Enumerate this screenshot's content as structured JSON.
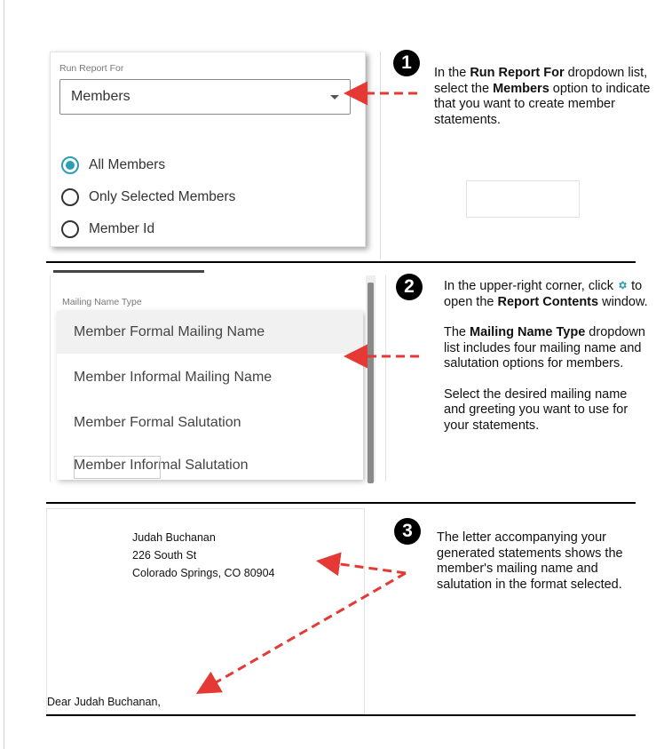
{
  "step1": {
    "number": "1",
    "panel": {
      "label": "Run Report For",
      "selected_value": "Members",
      "options": [
        {
          "label": "All Members",
          "checked": true
        },
        {
          "label": "Only Selected Members",
          "checked": false
        },
        {
          "label": "Member Id",
          "checked": false
        }
      ]
    },
    "text": {
      "a": "In the ",
      "b1": "Run Report For",
      "c": " dropdown list, select the ",
      "b2": "Members",
      "d": " option to indicate that you want to create member statements."
    }
  },
  "step2": {
    "number": "2",
    "panel": {
      "label": "Mailing Name Type",
      "items": [
        "Member Formal Mailing Name",
        "Member Informal Mailing Name",
        "Member Formal Salutation",
        "Member Informal Salutation"
      ]
    },
    "text": {
      "p1a": "In the upper-right corner, click ",
      "p1b": " to open the ",
      "p1bold": "Report Contents",
      "p1c": " window.",
      "p2bold": "Mailing Name Type",
      "p2pre": "The ",
      "p2rest": " dropdown list includes four mailing name and salutation options for members.",
      "p3": "Select the desired mailing name and greeting you want to use for your statements."
    },
    "gear_color": "#2a9fb4"
  },
  "step3": {
    "number": "3",
    "letter": {
      "name": "Judah Buchanan",
      "street": "226 South St",
      "city": "Colorado Springs, CO 80904",
      "greeting": "Dear Judah Buchanan,"
    },
    "text": "The letter accompanying your generated statements shows the member's mailing name and salutation in the format selected."
  },
  "colors": {
    "accent": "#2a9fb4",
    "arrow": "#e53935"
  }
}
